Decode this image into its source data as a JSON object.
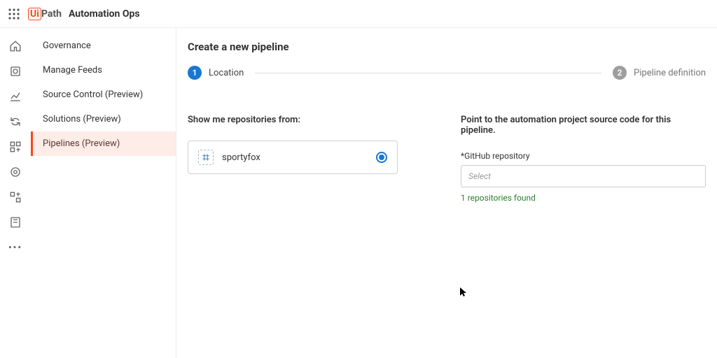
{
  "header": {
    "brand_ui": "Ui",
    "brand_path": "Path",
    "app_title": "Automation Ops"
  },
  "sidebar": {
    "items": [
      {
        "label": "Governance"
      },
      {
        "label": "Manage Feeds"
      },
      {
        "label": "Source Control (Preview)"
      },
      {
        "label": "Solutions (Preview)"
      },
      {
        "label": "Pipelines (Preview)"
      }
    ],
    "active_index": 4
  },
  "main": {
    "title": "Create a new pipeline",
    "steps": [
      {
        "num": "1",
        "label": "Location"
      },
      {
        "num": "2",
        "label": "Pipeline definition"
      }
    ],
    "left": {
      "heading": "Show me repositories from:",
      "repo_option": {
        "name": "sportyfox"
      }
    },
    "right": {
      "heading": "Point to the automation project source code for this pipeline.",
      "field_label": "*GitHub repository",
      "select_placeholder": "Select",
      "found_text": "1 repositories found"
    }
  }
}
